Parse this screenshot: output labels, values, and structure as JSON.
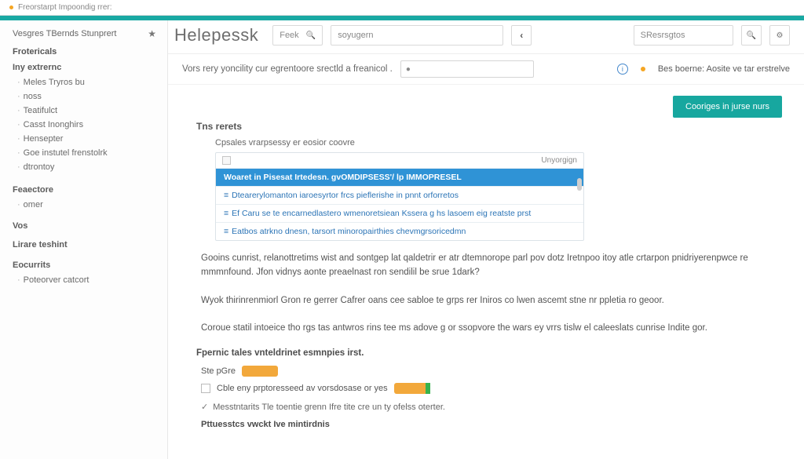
{
  "browser": {
    "tab_label": "Freorstarpt Impoondig rrer:"
  },
  "colors": {
    "accent_teal": "#19a9a3",
    "accent_blue": "#2f93d6",
    "accent_orange": "#f2a83b"
  },
  "sidebar": {
    "brand": "Vesgres TBernds Stunprert",
    "heading1": "Frotericals",
    "group1_title": "Iny extrernc",
    "group1_items": [
      "Meles Tryros bu",
      "noss",
      "Teatifulct",
      "Casst Inonghirs",
      "Hensepter",
      "Goe instutel frenstolrk",
      "dtrontoy"
    ],
    "group2_title": "Feaectore",
    "group2_items": [
      "omer"
    ],
    "group3_title": "Vos",
    "group4_title": "Lirare teshint",
    "group5_title": "Eocurrits",
    "group5_items": [
      "Poteorver catcort"
    ]
  },
  "topbar": {
    "title": "Helepessk",
    "field1": "Feek",
    "field1_icon": "search",
    "search_placeholder": "soyugern",
    "nav_caret": "‹",
    "right_input": "SResrsgtos"
  },
  "subheader": {
    "text": "Vors rery yoncility cur egrentoore srectld a freanicol .",
    "field_icon": "•",
    "right_dot": true,
    "right_text": "Bes boerne: Aosite ve tar erstrelve"
  },
  "content": {
    "section_title": "Tns rerets",
    "cta_label": "Cooriges in jurse nurs",
    "block_label": "Cpsales vrarpsessy er eosior coovre",
    "listing_top_right": "Unyorgign",
    "listing_rows": [
      "Woaret in Pisesat Irtedesn. gvOMDIPSESS'/ lp IMMOPRESEL",
      "Dtearerylomanton iaroesyrtor frcs pieflerishe in pnnt orforretos",
      "Ef Caru se te encarnedlastero wmenoretsiean Kssera g hs lasoem eig reatste prst",
      "Eatbos atrkno dnesn, tarsort minoropairthies chevmgrsoricedmn"
    ],
    "paragraph1": "Gooins cunrist, relanottretims wist and sontgep lat qaldetrir er atr dtemnorope parl pov dotz Iretnpoo itoy atle crtarpon pnidriyerenpwce re mmmnfound. Jfon vidnys aonte preaelnast ron sendilil be srue 1dark?",
    "paragraph2": "Wyok thirinrenmiorl Gron re gerrer Cafrer oans cee sabloe te grps rer Iniros co lwen ascemt stne nr ppletia ro geoor.",
    "paragraph3": "Coroue statil intoeice tho rgs tas antwros rins tee ms adove g or ssopvore the wars ey vrrs tislw el caleeslats cunrise Indite gor.",
    "subheading": "Fpernic tales vnteldrinet esmnpies irst.",
    "pill_row1_label": "Ste pGre",
    "check_row_label": "Cble eny prptoresseed av vorsdosase or yes",
    "footer1": "Messtntarits Tle toentie grenn Ifre tite cre un ty ofelss oterter.",
    "footer2": "Pttuesstcs vwckt Ive mintirdnis"
  }
}
